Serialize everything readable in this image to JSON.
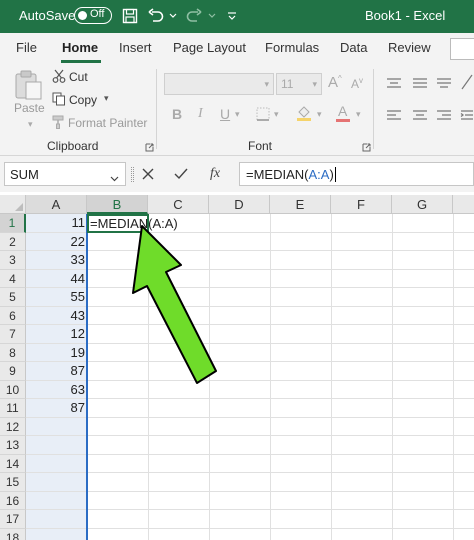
{
  "titlebar": {
    "autosave_label": "AutoSave",
    "autosave_state": "Off",
    "window_title": "Book1  -  Excel",
    "accent": "#217346"
  },
  "tabs": [
    "File",
    "Home",
    "Insert",
    "Page Layout",
    "Formulas",
    "Data",
    "Review"
  ],
  "active_tab": "Home",
  "ribbon": {
    "clipboard": {
      "paste": "Paste",
      "cut": "Cut",
      "copy": "Copy",
      "format_painter": "Format Painter",
      "group_label": "Clipboard"
    },
    "font": {
      "size": "11",
      "grow": "A",
      "shrink": "A",
      "bold": "B",
      "italic": "I",
      "underline": "U",
      "font_color": "A",
      "group_label": "Font"
    }
  },
  "formula_bar": {
    "name_box": "SUM",
    "fx": "fx",
    "formula_prefix": "=MEDIAN(",
    "formula_range": "A:A",
    "formula_suffix": ")"
  },
  "sheet": {
    "columns": [
      "A",
      "B",
      "C",
      "D",
      "E",
      "F",
      "G"
    ],
    "active_column": "B",
    "rows": [
      "1",
      "2",
      "3",
      "4",
      "5",
      "6",
      "7",
      "8",
      "9",
      "10",
      "11",
      "12",
      "13",
      "14",
      "15",
      "16",
      "17",
      "18"
    ],
    "active_row": "1",
    "column_a_values": [
      "11",
      "22",
      "33",
      "44",
      "55",
      "43",
      "12",
      "19",
      "87",
      "63",
      "87"
    ],
    "active_cell_text": "=MEDIAN(A:A)",
    "arrow_color": "#6fdc2a"
  }
}
